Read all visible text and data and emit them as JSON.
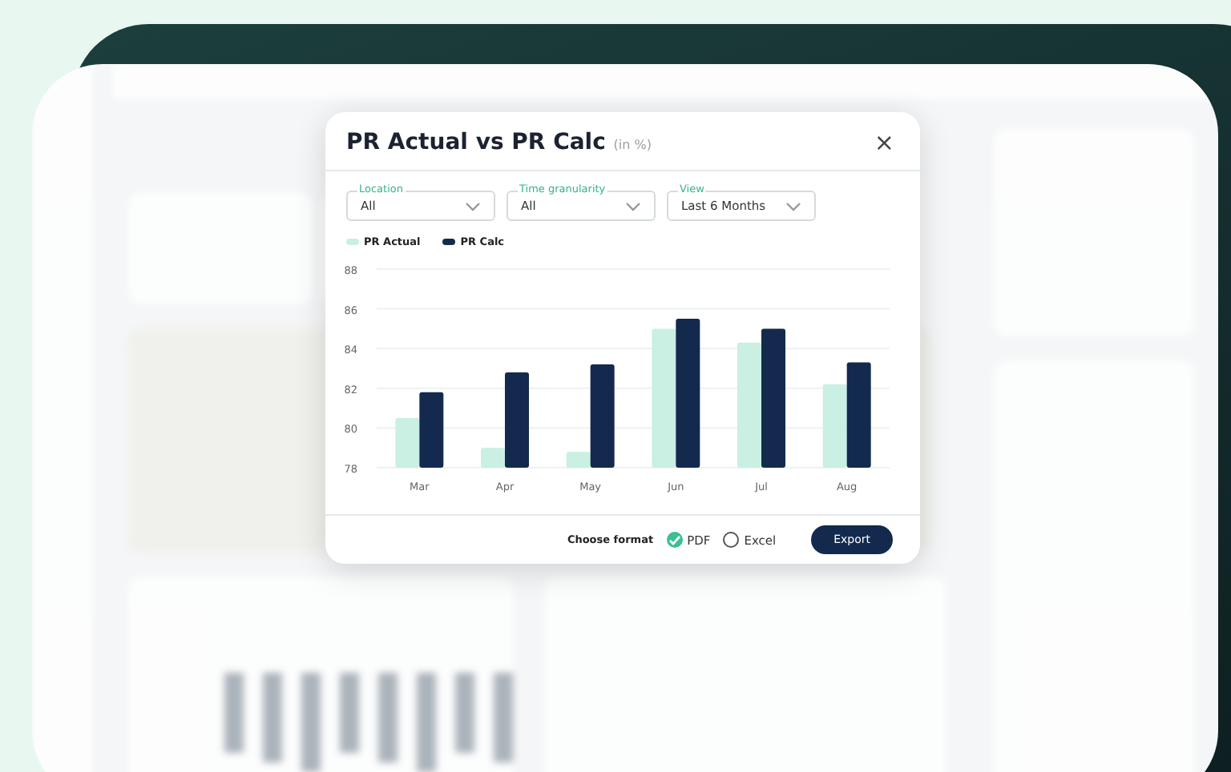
{
  "dialog": {
    "title": "PR Actual vs PR Calc",
    "title_note": "(in %)",
    "close": "×",
    "filters": [
      {
        "label": "Location",
        "value": "All"
      },
      {
        "label": "Time granularity",
        "value": "All"
      },
      {
        "label": "View",
        "value": "Last 6 Months"
      }
    ],
    "chart_data": {
      "type": "bar",
      "grid": true,
      "categories": [
        "Mar",
        "Apr",
        "May",
        "Jun",
        "Jul",
        "Aug"
      ],
      "ylim": [
        78,
        88
      ],
      "yticks": [
        78,
        80,
        82,
        84,
        86,
        88
      ],
      "series": [
        {
          "name": "PR Actual",
          "color": "#c9f0e3",
          "values": [
            80.5,
            79.0,
            78.8,
            85.0,
            84.3,
            82.2
          ]
        },
        {
          "name": "PR Calc",
          "color": "#132a4e",
          "values": [
            81.8,
            82.8,
            83.2,
            85.5,
            85.0,
            83.3
          ]
        }
      ]
    },
    "format_label": "Choose format",
    "formats": [
      {
        "label": "PDF",
        "selected": true
      },
      {
        "label": "Excel",
        "selected": false
      }
    ],
    "export": "Export"
  }
}
